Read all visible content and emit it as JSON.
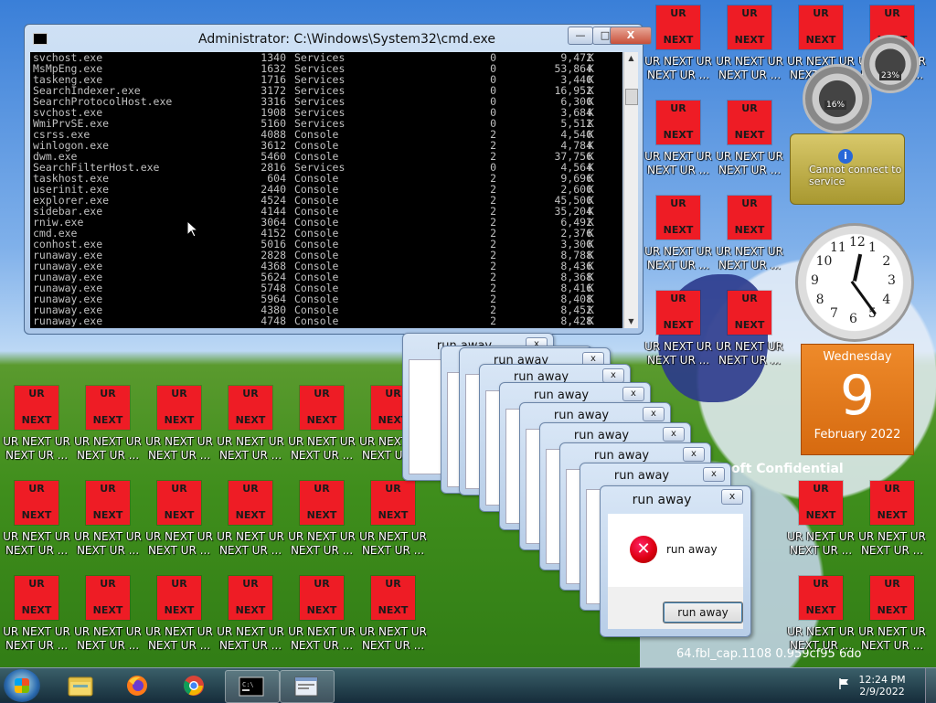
{
  "icon_labels": {
    "ur": "UR",
    "next": "NEXT",
    "label_line1": "UR NEXT UR",
    "label_line2": "NEXT UR ...",
    "label_line1_short": "UR NEXT UR",
    "label_line2_short": "NEXT UR"
  },
  "wallpaper": {
    "confidential": "oft Confidential",
    "build_string": "64.fbl_cap.1108 0.959cf95 6do"
  },
  "cmd": {
    "title": "Administrator: C:\\Windows\\System32\\cmd.exe",
    "controls": {
      "minimize": "—",
      "maximize": "□",
      "close": "X"
    },
    "rows": [
      {
        "name": "svchost.exe",
        "pid": "1340",
        "session": "Services",
        "num": "0",
        "mem": "9,472",
        "unit": "K"
      },
      {
        "name": "MsMpEng.exe",
        "pid": "1632",
        "session": "Services",
        "num": "0",
        "mem": "53,864",
        "unit": "K"
      },
      {
        "name": "taskeng.exe",
        "pid": "1716",
        "session": "Services",
        "num": "0",
        "mem": "3,440",
        "unit": "K"
      },
      {
        "name": "SearchIndexer.exe",
        "pid": "3172",
        "session": "Services",
        "num": "0",
        "mem": "16,952",
        "unit": "K"
      },
      {
        "name": "SearchProtocolHost.exe",
        "pid": "3316",
        "session": "Services",
        "num": "0",
        "mem": "6,300",
        "unit": "K"
      },
      {
        "name": "svchost.exe",
        "pid": "1908",
        "session": "Services",
        "num": "0",
        "mem": "3,684",
        "unit": "K"
      },
      {
        "name": "WmiPrvSE.exe",
        "pid": "5160",
        "session": "Services",
        "num": "0",
        "mem": "5,512",
        "unit": "K"
      },
      {
        "name": "csrss.exe",
        "pid": "4088",
        "session": "Console",
        "num": "2",
        "mem": "4,540",
        "unit": "K"
      },
      {
        "name": "winlogon.exe",
        "pid": "3612",
        "session": "Console",
        "num": "2",
        "mem": "4,784",
        "unit": "K"
      },
      {
        "name": "dwm.exe",
        "pid": "5460",
        "session": "Console",
        "num": "2",
        "mem": "37,756",
        "unit": "K"
      },
      {
        "name": "SearchFilterHost.exe",
        "pid": "2816",
        "session": "Services",
        "num": "0",
        "mem": "4,564",
        "unit": "K"
      },
      {
        "name": "taskhost.exe",
        "pid": "604",
        "session": "Console",
        "num": "2",
        "mem": "9,696",
        "unit": "K"
      },
      {
        "name": "userinit.exe",
        "pid": "2440",
        "session": "Console",
        "num": "2",
        "mem": "2,600",
        "unit": "K"
      },
      {
        "name": "explorer.exe",
        "pid": "4524",
        "session": "Console",
        "num": "2",
        "mem": "45,500",
        "unit": "K"
      },
      {
        "name": "sidebar.exe",
        "pid": "4144",
        "session": "Console",
        "num": "2",
        "mem": "35,204",
        "unit": "K"
      },
      {
        "name": "rniw.exe",
        "pid": "3064",
        "session": "Console",
        "num": "2",
        "mem": "6,492",
        "unit": "K"
      },
      {
        "name": "cmd.exe",
        "pid": "4152",
        "session": "Console",
        "num": "2",
        "mem": "2,376",
        "unit": "K"
      },
      {
        "name": "conhost.exe",
        "pid": "5016",
        "session": "Console",
        "num": "2",
        "mem": "3,300",
        "unit": "K"
      },
      {
        "name": "runaway.exe",
        "pid": "2828",
        "session": "Console",
        "num": "2",
        "mem": "8,788",
        "unit": "K"
      },
      {
        "name": "runaway.exe",
        "pid": "4368",
        "session": "Console",
        "num": "2",
        "mem": "8,436",
        "unit": "K"
      },
      {
        "name": "runaway.exe",
        "pid": "5624",
        "session": "Console",
        "num": "2",
        "mem": "8,368",
        "unit": "K"
      },
      {
        "name": "runaway.exe",
        "pid": "5748",
        "session": "Console",
        "num": "2",
        "mem": "8,416",
        "unit": "K"
      },
      {
        "name": "runaway.exe",
        "pid": "5964",
        "session": "Console",
        "num": "2",
        "mem": "8,408",
        "unit": "K"
      },
      {
        "name": "runaway.exe",
        "pid": "4380",
        "session": "Console",
        "num": "2",
        "mem": "8,452",
        "unit": "K"
      },
      {
        "name": "runaway.exe",
        "pid": "4748",
        "session": "Console",
        "num": "2",
        "mem": "8,428",
        "unit": "K"
      }
    ]
  },
  "dialogs": {
    "title": "run away",
    "close": "x",
    "message": "run away",
    "button": "run away"
  },
  "gadgets": {
    "cpu_pct": "16%",
    "mem_pct": "23%",
    "weather_message": "Cannot connect to service",
    "calendar": {
      "weekday": "Wednesday",
      "day": "9",
      "month_year": "February 2022"
    },
    "clock": {
      "hour": 12,
      "minute": 24
    }
  },
  "taskbar": {
    "time": "12:24 PM",
    "date": "2/9/2022",
    "apps": [
      "explorer-icon",
      "firefox-icon",
      "chrome-icon",
      "cmd-icon",
      "runaway-icon"
    ]
  },
  "colors": {
    "icon_red": "#ee1c25",
    "calendar_orange": "#ee8a2a"
  }
}
